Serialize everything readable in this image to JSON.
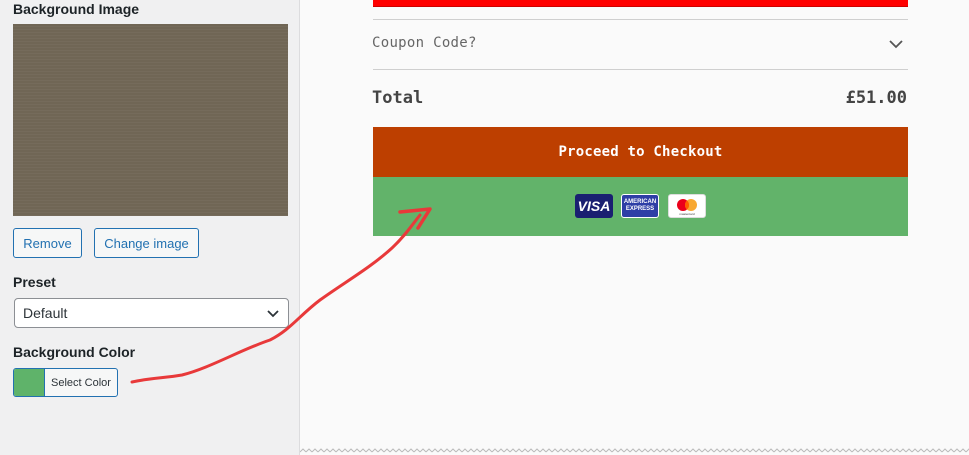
{
  "customizer": {
    "background_image_label": "Background Image",
    "remove_label": "Remove",
    "change_image_label": "Change image",
    "preset_label": "Preset",
    "preset_value": "Default",
    "background_color_label": "Background Color",
    "select_color_label": "Select Color",
    "selected_color": "#5fb36a"
  },
  "preview": {
    "coupon_label": "Coupon Code?",
    "total_label": "Total",
    "total_value": "£51.00",
    "checkout_label": "Proceed to Checkout",
    "checkout_color": "#bd3f00",
    "payment_bg": "#62b36a",
    "cards": {
      "visa": "VISA",
      "amex_line1": "AMERICAN",
      "amex_line2": "EXPRESS",
      "mastercard": "mastercard"
    }
  },
  "annotation": {
    "arrow_color": "#e8393a"
  }
}
